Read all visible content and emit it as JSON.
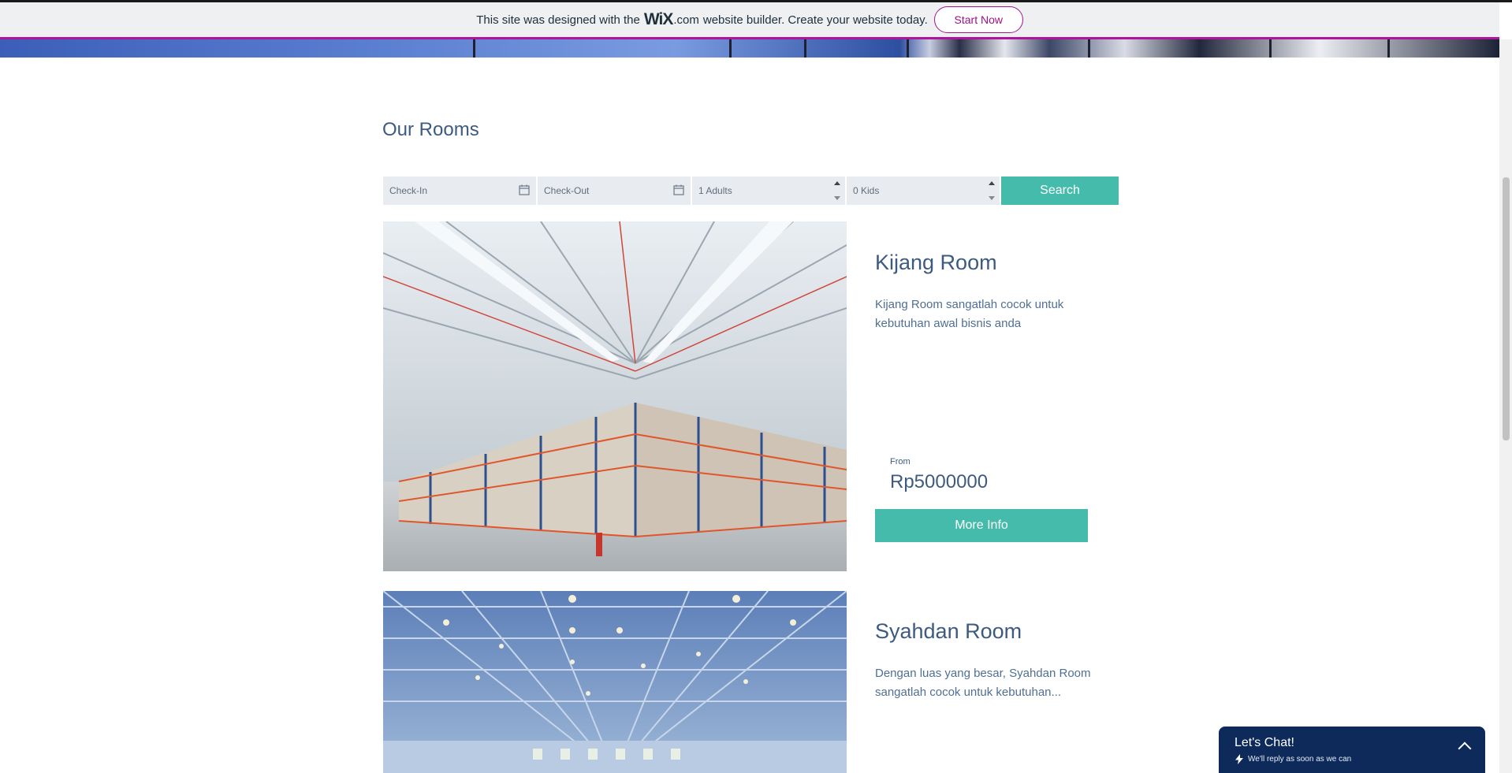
{
  "banner": {
    "text_before": "This site was designed with the",
    "logo": "WiX",
    "dotcom": ".com",
    "text_after": "website builder. Create your website today.",
    "start_label": "Start Now"
  },
  "section_title": "Our Rooms",
  "search": {
    "checkin_placeholder": "Check-In",
    "checkout_placeholder": "Check-Out",
    "adults_value": "1 Adults",
    "kids_value": "0 Kids",
    "search_label": "Search"
  },
  "rooms": [
    {
      "title": "Kijang Room",
      "description": "Kijang Room sangatlah cocok untuk kebutuhan awal bisnis anda",
      "from_label": "From",
      "price": "Rp5000000",
      "button_label": "More Info"
    },
    {
      "title": "Syahdan Room",
      "description": "Dengan luas yang besar, Syahdan Room sangatlah cocok untuk kebutuhan..."
    }
  ],
  "chat": {
    "title": "Let's Chat!",
    "subtitle": "We'll reply as soon as we can"
  },
  "colors": {
    "accent": "#45bcab",
    "text": "#3d5a80",
    "wix_magenta": "#b0139e",
    "chat_bg": "#0e2a5a"
  },
  "icons": [
    "calendar-icon",
    "spinner-icon",
    "lightning-icon",
    "chevron-up-icon"
  ]
}
